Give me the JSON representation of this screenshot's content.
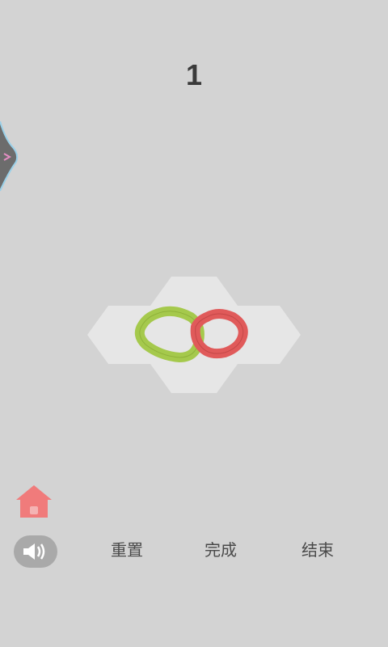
{
  "level": {
    "number": "1"
  },
  "controls": {
    "reset_label": "重置",
    "done_label": "完成",
    "end_label": "结束"
  },
  "icons": {
    "home": "home-icon",
    "sound": "speaker-icon",
    "side_tab": "chevron-right-icon"
  },
  "colors": {
    "background": "#d3d3d3",
    "tile": "#e6e6e6",
    "ring_green": "#a5c94c",
    "ring_red": "#e05a5a",
    "home": "#f07b7b",
    "sound_button": "#a9a9a9"
  }
}
